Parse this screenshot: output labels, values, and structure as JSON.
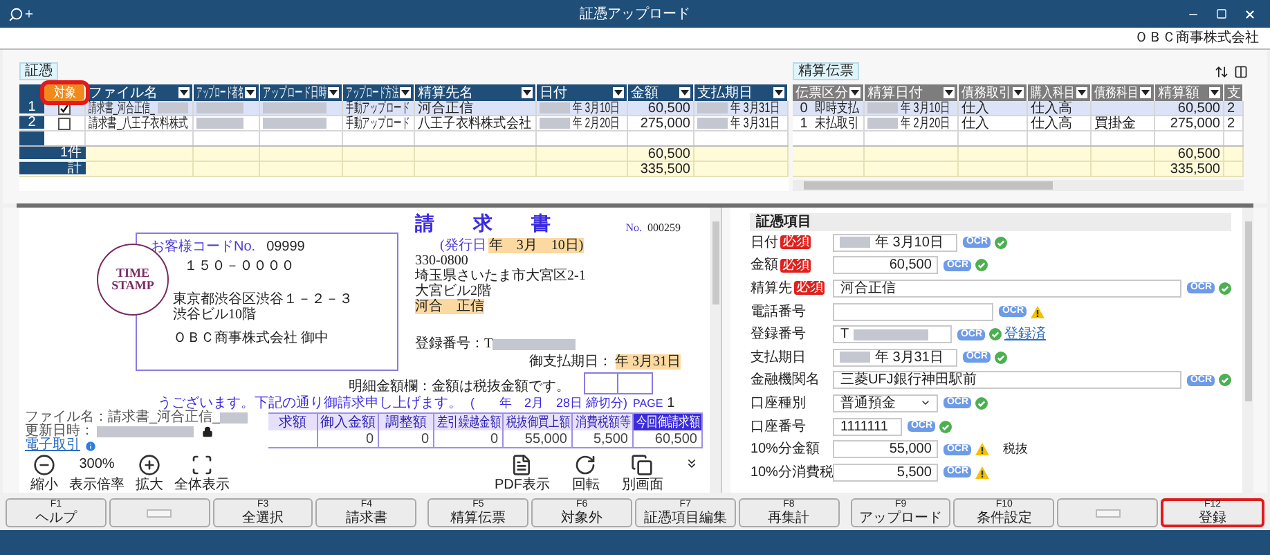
{
  "window": {
    "title": "証憑アップロード",
    "company": "ＯＢＣ商事株式会社"
  },
  "voucher_tag": "証憑",
  "settlement_tag": "精算伝票",
  "left_columns": [
    {
      "label": "対象",
      "highlighted": true
    },
    {
      "label": "ファイル名",
      "highlighted": false
    },
    {
      "label": "アップロード者名",
      "highlighted": false
    },
    {
      "label": "アップロード日時",
      "highlighted": false
    },
    {
      "label": "アップロード方法",
      "highlighted": false
    },
    {
      "label": "精算先名",
      "highlighted": false
    },
    {
      "label": "日付",
      "highlighted": false
    },
    {
      "label": "金額",
      "highlighted": false
    },
    {
      "label": "支払期日",
      "highlighted": false
    }
  ],
  "right_columns": [
    {
      "label": "伝票区分"
    },
    {
      "label": "精算日付"
    },
    {
      "label": "債務取引"
    },
    {
      "label": "購入科目"
    },
    {
      "label": "債務科目"
    },
    {
      "label": "精算額"
    },
    {
      "label": "支"
    }
  ],
  "rows": [
    {
      "num": "1",
      "selected": true,
      "checked": true,
      "cells": [
        {
          "text": "請求書_河合正信_",
          "redacted_after": true
        },
        {
          "redacted": true
        },
        {
          "redacted": true
        },
        {
          "text": "手動アップロード"
        },
        {
          "text": "河合正信"
        },
        {
          "text": "年 3月10日",
          "redacted_before": true
        },
        {
          "text": "60,500"
        },
        {
          "text": "年 3月31日",
          "redacted_before": true
        }
      ],
      "settlement_cells": [
        {
          "code": "0",
          "text": "即時支払"
        },
        {
          "text": "年 3月10日",
          "redacted_before": true
        },
        {
          "text": "仕入"
        },
        {
          "text": "仕入高"
        },
        {},
        {
          "text": "60,500"
        },
        {
          "text": "2"
        }
      ]
    },
    {
      "num": "2",
      "selected": false,
      "checked": false,
      "cells": [
        {
          "text": "請求書_八王子衣料株式"
        },
        {
          "redacted": true
        },
        {
          "redacted": true
        },
        {
          "text": "手動アップロード"
        },
        {
          "text": "八王子衣料株式会社"
        },
        {
          "text": "年 2月20日",
          "redacted_before": true
        },
        {
          "text": "275,000"
        },
        {
          "text": "年 3月31日",
          "redacted_before": true
        }
      ],
      "settlement_cells": [
        {
          "code": "1",
          "text": "未払取引"
        },
        {
          "text": "年 2月20日",
          "redacted_before": true
        },
        {
          "text": "仕入"
        },
        {
          "text": "仕入高"
        },
        {
          "text": "買掛金"
        },
        {
          "text": "275,000"
        },
        {
          "text": "2"
        }
      ]
    }
  ],
  "totals": [
    {
      "label": "1件",
      "amount": "60,500",
      "settlement": "60,500"
    },
    {
      "label": "計",
      "amount": "335,500",
      "settlement": "335,500"
    }
  ],
  "document": {
    "stamp": [
      "TIME",
      "STAMP"
    ],
    "customer_code_label": "お客様コードNo.",
    "customer_code": "09999",
    "postal": "１５０－００００",
    "address": [
      "東京都渋谷区渋谷１－２－３",
      "渋谷ビル10階"
    ],
    "recipient": "ＯＢＣ商事株式会社 御中",
    "title": "請　　求　　書",
    "no_label": "No.",
    "no": "000259",
    "issue_label": "(発行日",
    "issue_date": {
      "text": "年　3月　10日)",
      "highlighted": true
    },
    "sender": [
      "330-0800",
      "埼玉県さいたま市大宮区2-1",
      "大宮ビル2階"
    ],
    "sender_name": {
      "text": "河合　正信",
      "highlighted": true
    },
    "registration": "登録番号：T",
    "due_label": "御支払期日：",
    "due_date": {
      "text": "年 3月31日",
      "highlighted": true
    },
    "note": "明細金額欄：金額は税抜金額です。",
    "greeting": "うございます。下記の通り御請求申し上げます。",
    "period": "(　　年　2月　28日 締切分)",
    "page_label": "PAGE",
    "page": "1",
    "table": [
      {
        "label": "求額",
        "highlighted": false
      },
      {
        "label": "御入金額",
        "value": "0",
        "highlighted": false
      },
      {
        "label": "調整額",
        "value": "0",
        "highlighted": false
      },
      {
        "label": "差引繰越金額",
        "value": "0",
        "highlighted": false
      },
      {
        "label": "税抜御買上額",
        "value": "55,000",
        "highlighted": false
      },
      {
        "label": "消費税額等",
        "value": "5,500",
        "highlighted": false
      },
      {
        "label": "今回御請求額",
        "value": "60,500",
        "highlighted": true
      }
    ]
  },
  "file_info": {
    "file_label": "ファイル名：請求書_河合正信_",
    "updated_label": "更新日時：",
    "link": "電子取引"
  },
  "toolbar_left": [
    {
      "kind": "zoom-out",
      "label": "縮小"
    },
    {
      "kind": "zoom",
      "value": "300%",
      "label": "表示倍率"
    },
    {
      "kind": "zoom-in",
      "label": "拡大"
    },
    {
      "kind": "fit",
      "label": "全体表示"
    }
  ],
  "toolbar_right": [
    {
      "kind": "pdf",
      "label": "PDF表示"
    },
    {
      "kind": "rotate",
      "label": "回転"
    },
    {
      "kind": "window",
      "label": "別画面"
    }
  ],
  "form": {
    "title": "証憑項目",
    "rows": [
      {
        "label": "日付",
        "required": "必須",
        "kind": "date",
        "value": "年 3月10日",
        "redacted": true,
        "ocr": "OCR",
        "verified": true
      },
      {
        "label": "金額",
        "required": "必須",
        "kind": "amount",
        "value": "60,500",
        "ocr": "OCR",
        "verified": true
      },
      {
        "label": "精算先",
        "required": "必須",
        "kind": "wide",
        "value": "河合正信",
        "ocr": "OCR",
        "verified": true
      },
      {
        "label": "電話番号",
        "kind": "phone",
        "ocr": "OCR",
        "verified": false
      },
      {
        "label": "登録番号",
        "kind": "reg",
        "value": "T",
        "redacted": true,
        "ocr": "OCR",
        "verified": true,
        "link": "登録済"
      },
      {
        "label": "支払期日",
        "kind": "date",
        "value": "年 3月31日",
        "redacted": true,
        "ocr": "OCR",
        "verified": true
      },
      {
        "label": "金融機関名",
        "kind": "wide",
        "value": "三菱UFJ銀行神田駅前",
        "ocr": "OCR",
        "verified": true
      },
      {
        "label": "口座種別",
        "kind": "select",
        "value": "普通預金",
        "ocr": "OCR",
        "verified": true
      },
      {
        "label": "口座番号",
        "kind": "short",
        "value": "1111111",
        "ocr": "OCR",
        "verified": true
      },
      {
        "label": "10%分金額",
        "kind": "amount",
        "value": "55,000",
        "ocr": "OCR",
        "verified": false,
        "note": "税抜"
      },
      {
        "label": "10%分消費税",
        "kind": "amount",
        "value": "5,500",
        "ocr": "OCR",
        "verified": false
      }
    ]
  },
  "function_keys": [
    {
      "kind": "key",
      "key": "F1",
      "label": "ヘルプ",
      "highlighted": false
    },
    {
      "kind": "blank",
      "highlighted": false
    },
    {
      "kind": "key",
      "key": "F3",
      "label": "全選択",
      "highlighted": false
    },
    {
      "kind": "key",
      "key": "F4",
      "label": "請求書",
      "highlighted": false
    },
    {
      "kind": "key",
      "key": "F5",
      "label": "精算伝票",
      "highlighted": false
    },
    {
      "kind": "key",
      "key": "F6",
      "label": "対象外",
      "highlighted": false
    },
    {
      "kind": "key",
      "key": "F7",
      "label": "証憑項目編集",
      "highlighted": false
    },
    {
      "kind": "key",
      "key": "F8",
      "label": "再集計",
      "highlighted": false
    },
    {
      "kind": "key",
      "key": "F9",
      "label": "アップロード",
      "highlighted": false
    },
    {
      "kind": "key",
      "key": "F10",
      "label": "条件設定",
      "highlighted": false
    },
    {
      "kind": "blank",
      "highlighted": false
    },
    {
      "kind": "key",
      "key": "F12",
      "label": "登録",
      "highlighted": true
    }
  ]
}
